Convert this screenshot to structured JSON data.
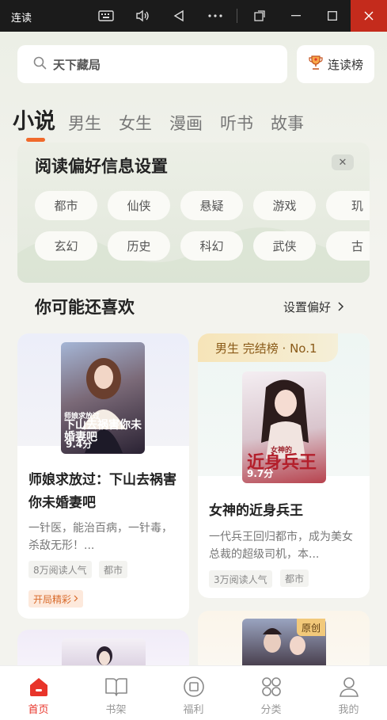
{
  "window": {
    "title": "连读"
  },
  "search": {
    "placeholder": "天下藏局"
  },
  "rank_button": {
    "label": "连读榜"
  },
  "tabs": [
    {
      "label": "小说",
      "active": true
    },
    {
      "label": "男生"
    },
    {
      "label": "女生"
    },
    {
      "label": "漫画"
    },
    {
      "label": "听书"
    },
    {
      "label": "故事"
    }
  ],
  "preferences": {
    "title": "阅读偏好信息设置",
    "close_icon": "close-icon",
    "genres_row1": [
      "都市",
      "仙侠",
      "悬疑",
      "游戏",
      "玑"
    ],
    "genres_row2": [
      "玄幻",
      "历史",
      "科幻",
      "武侠",
      "古"
    ]
  },
  "section": {
    "title": "你可能还喜欢",
    "link": "设置偏好"
  },
  "cards": [
    {
      "title": "师娘求放过：下山去祸害你未婚妻吧",
      "rating": "9.4分",
      "desc": "一针医，能治百病，一针毒，杀敌无形！...",
      "tags": [
        "8万阅读人气",
        "都市"
      ],
      "highlight": "开局精彩",
      "cover_text": "下山去祸害你未婚妻吧",
      "cover_subtext": "师娘求放过"
    },
    {
      "ribbon": "男生 完结榜 · No.1",
      "title": "女神的近身兵王",
      "rating": "9.7分",
      "desc": "一代兵王回归都市，成为美女总裁的超级司机，本...",
      "tags": [
        "3万阅读人气",
        "都市"
      ],
      "cover_text": "近身兵王",
      "cover_subtext": "女神的"
    },
    {
      "badge": "原创"
    }
  ],
  "bottom_nav": [
    {
      "label": "首页",
      "icon": "home-icon",
      "active": true
    },
    {
      "label": "书架",
      "icon": "bookshelf-icon"
    },
    {
      "label": "福利",
      "icon": "welfare-icon"
    },
    {
      "label": "分类",
      "icon": "category-icon"
    },
    {
      "label": "我的",
      "icon": "profile-icon"
    }
  ],
  "colors": {
    "accent": "#e8342a",
    "tab_underline": "#f06a2b",
    "ribbon_text": "#8a5a18"
  }
}
